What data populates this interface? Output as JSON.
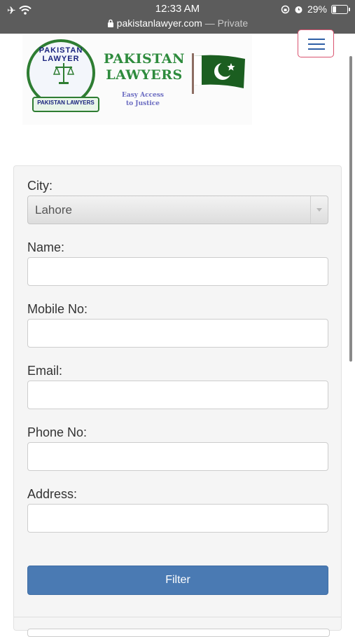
{
  "statusbar": {
    "time": "12:33 AM",
    "url": "pakistanlawyer.com",
    "private_label": "— Private",
    "battery": "29%",
    "battery_level": 0.29,
    "icons": [
      "airplane-icon",
      "wifi-icon",
      "lock-icon",
      "rotation-lock-icon",
      "alarm-icon",
      "battery-icon"
    ]
  },
  "header": {
    "seal_top_text": "PAKISTAN LAWYER",
    "seal_ribbon_text": "PAKISTAN LAWYERS",
    "brand_line1": "PAKISTAN",
    "brand_line2": "LAWYERS",
    "tagline_line1": "Easy Access",
    "tagline_line2": "to Justice",
    "menu_icon": "hamburger-menu-icon"
  },
  "form": {
    "city_label": "City:",
    "city_value": "Lahore",
    "name_label": "Name:",
    "name_value": "",
    "mobile_label": "Mobile No:",
    "mobile_value": "",
    "email_label": "Email:",
    "email_value": "",
    "phone_label": "Phone No:",
    "phone_value": "",
    "address_label": "Address:",
    "address_value": "",
    "filter_label": "Filter"
  },
  "colors": {
    "statusbar_bg": "#5c5c5c",
    "brand_green": "#2e8b3d",
    "button_blue": "#4a7ab3",
    "menu_border": "#d9536f"
  }
}
